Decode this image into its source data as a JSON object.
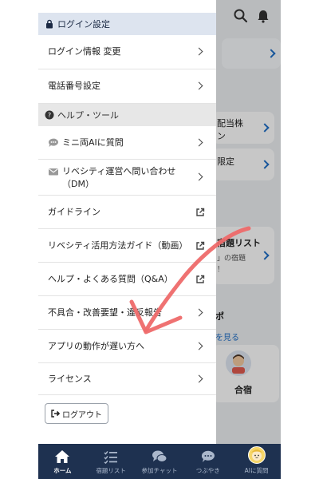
{
  "drawer": {
    "login_section_title": "ログイン設定",
    "login_info_label": "ログイン情報 変更",
    "phone_setting_label": "電話番号設定",
    "help_section_title": "ヘルプ・ツール",
    "ask_ai_label": "ミニ両AIに質問",
    "dm_label": "リベシティ運営へ問い合わせ（DM）",
    "guideline_label": "ガイドライン",
    "howto_label": "リベシティ活用方法ガイド（動画）",
    "faq_label": "ヘルプ・よくある質問（Q&A）",
    "bug_report_label": "不具合・改善要望・違反報告",
    "slow_app_label": "アプリの動作が遅い方へ",
    "license_label": "ライセンス",
    "logout_label": "ログアウト"
  },
  "background": {
    "card1_line1": "配当株",
    "card1_line2": "ン",
    "card2_line1": "限定",
    "card3_title": "宿題リスト",
    "card3_line2": "」の宿題",
    "card3_line3": "！",
    "section_char": "ポ",
    "see_more": "を見る",
    "gasshuku_label": "合宿"
  },
  "bottom_nav": {
    "home": "ホーム",
    "homework": "宿題リスト",
    "chat": "参加チャット",
    "tweet": "つぶやき",
    "ai": "AIに質問"
  },
  "colors": {
    "header_bar": "#1e3150",
    "section_blue": "#dde4ef",
    "section_gray": "#e7e7e7",
    "accent_blue": "#1f6fc7",
    "annotation_red": "#ee6a6a"
  }
}
